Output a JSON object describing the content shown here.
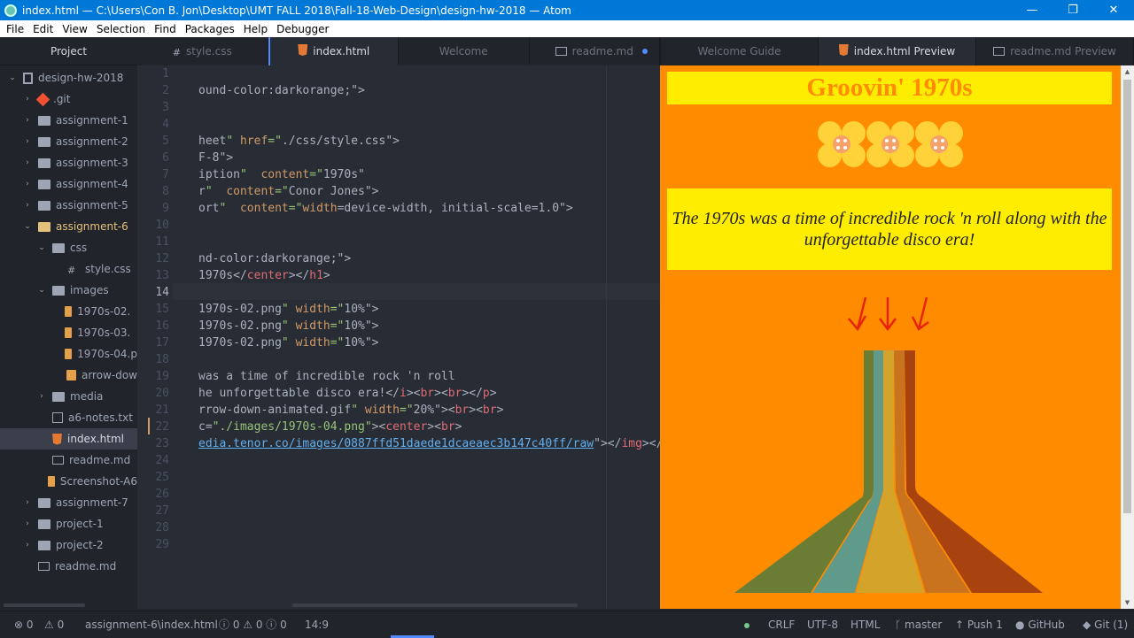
{
  "window": {
    "title": "index.html — C:\\Users\\Con B. Jon\\Desktop\\UMT FALL 2018\\Fall-18-Web-Design\\design-hw-2018 — Atom",
    "minimize": "—",
    "restore": "❐",
    "close": "✕"
  },
  "menu": [
    "File",
    "Edit",
    "View",
    "Selection",
    "Find",
    "Packages",
    "Help",
    "Debugger"
  ],
  "tree": {
    "title": "Project",
    "items": [
      {
        "label": "design-hw-2018",
        "icon": "repo-icon",
        "chev": "⌄"
      },
      {
        "label": ".git",
        "icon": "git-icon",
        "chev": "›"
      },
      {
        "label": "assignment-1",
        "icon": "folder-icon",
        "chev": "›"
      },
      {
        "label": "assignment-2",
        "icon": "folder-icon",
        "chev": "›"
      },
      {
        "label": "assignment-3",
        "icon": "folder-icon",
        "chev": "›"
      },
      {
        "label": "assignment-4",
        "icon": "folder-icon",
        "chev": "›"
      },
      {
        "label": "assignment-5",
        "icon": "folder-icon",
        "chev": "›"
      },
      {
        "label": "assignment-6",
        "icon": "folder-open-icon",
        "chev": "⌄"
      },
      {
        "label": "css",
        "icon": "folder-icon",
        "chev": "⌄"
      },
      {
        "label": "style.css",
        "icon": "css-file-icon",
        "chev": ""
      },
      {
        "label": "images",
        "icon": "folder-icon",
        "chev": "⌄"
      },
      {
        "label": "1970s-02.p",
        "icon": "image-file-icon",
        "chev": ""
      },
      {
        "label": "1970s-03.p",
        "icon": "image-file-icon",
        "chev": ""
      },
      {
        "label": "1970s-04.p",
        "icon": "image-file-icon",
        "chev": ""
      },
      {
        "label": "arrow-dow",
        "icon": "image-file-icon",
        "chev": ""
      },
      {
        "label": "media",
        "icon": "folder-icon",
        "chev": "›"
      },
      {
        "label": "a6-notes.txt",
        "icon": "text-file-icon",
        "chev": ""
      },
      {
        "label": "index.html",
        "icon": "html-file-icon",
        "chev": ""
      },
      {
        "label": "readme.md",
        "icon": "markdown-file-icon",
        "chev": ""
      },
      {
        "label": "Screenshot-A6",
        "icon": "image-file-icon",
        "chev": ""
      },
      {
        "label": "assignment-7",
        "icon": "folder-icon",
        "chev": "›"
      },
      {
        "label": "project-1",
        "icon": "folder-icon",
        "chev": "›"
      },
      {
        "label": "project-2",
        "icon": "folder-icon",
        "chev": "›"
      },
      {
        "label": "readme.md",
        "icon": "markdown-file-icon",
        "chev": ""
      }
    ]
  },
  "editor_tabs": [
    {
      "label": "style.css"
    },
    {
      "label": "index.html"
    },
    {
      "label": "Welcome"
    },
    {
      "label": "readme.md"
    }
  ],
  "preview_tabs": [
    {
      "label": "Welcome Guide"
    },
    {
      "label": "index.html Preview"
    },
    {
      "label": "readme.md Preview"
    }
  ],
  "editor": {
    "line_numbers": [
      "1",
      "2",
      "3",
      "4",
      "5",
      "6",
      "7",
      "8",
      "9",
      "10",
      "11",
      "12",
      "13",
      "14",
      "15",
      "16",
      "17",
      "18",
      "19",
      "20",
      "21",
      "22",
      "23",
      "24",
      "25",
      "26",
      "27",
      "28",
      "29"
    ],
    "lines": [
      "",
      "ound-color:darkorange;\">",
      "",
      "",
      "heet\" href=\"./css/style.css\">",
      "F-8\">",
      "iption\"  content=\"1970s\"",
      "r\"  content=\"Conor Jones\">",
      "ort\"  content=\"width=device-width, initial-scale=1.0\">",
      "",
      "",
      "nd-color:darkorange;\">",
      "1970s</center></h1>",
      "",
      "1970s-02.png\" width=\"10%\">",
      "1970s-02.png\" width=\"10%\">",
      "1970s-02.png\" width=\"10%\">",
      "",
      "was a time of incredible rock 'n roll",
      "he unforgettable disco era!</i><br><br></p>",
      "rrow-down-animated.gif\" width=\"20%\"><br><br>",
      "c=\"./images/1970s-04.png\"><center><br>",
      "edia.tenor.co/images/0887ffd51daede1dcaeaec3b147c40ff/raw\"></img></",
      "",
      "",
      "",
      "",
      "",
      ""
    ]
  },
  "preview": {
    "heading": "Groovin' 1970s",
    "paragraph": "The 1970s was a time of incredible rock 'n roll along with the unforgettable disco era!",
    "bg_color": "#ff8c00",
    "box_color": "#ffed00"
  },
  "status": {
    "errors": "0",
    "warnings": "0",
    "path": "assignment-6\\index.html",
    "lint": "0 ⚠ 0 ⓘ 0",
    "cursor": "14:9",
    "line_ending": "CRLF",
    "encoding": "UTF-8",
    "grammar": "HTML",
    "branch": "master",
    "push": "Push 1",
    "github": "GitHub",
    "git": "Git (1)"
  }
}
